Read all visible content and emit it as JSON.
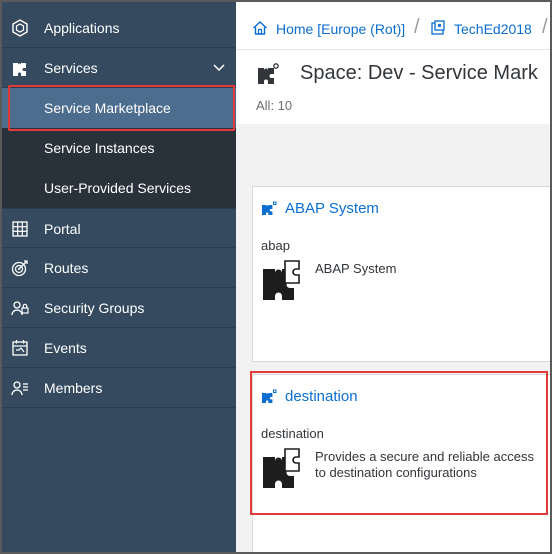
{
  "sidebar": {
    "items": [
      {
        "label": "Applications",
        "icon": "applications-icon"
      },
      {
        "label": "Services",
        "icon": "services-icon"
      },
      {
        "label": "Service Marketplace"
      },
      {
        "label": "Service Instances"
      },
      {
        "label": "User-Provided Services"
      },
      {
        "label": "Portal",
        "icon": "portal-grid-icon"
      },
      {
        "label": "Routes",
        "icon": "routes-target-icon"
      },
      {
        "label": "Security Groups",
        "icon": "security-groups-icon"
      },
      {
        "label": "Events",
        "icon": "events-calendar-icon"
      },
      {
        "label": "Members",
        "icon": "members-icon"
      }
    ]
  },
  "breadcrumb": {
    "home": "Home [Europe (Rot)]",
    "org": "TechEd2018",
    "separator": "/"
  },
  "header": {
    "title": "Space: Dev - Service Mark",
    "count": "All: 10"
  },
  "tiles": [
    {
      "title": "ABAP System",
      "name": "abap",
      "description": "ABAP System"
    },
    {
      "title": "destination",
      "name": "destination",
      "description": "Provides a secure and reliable access to destination configurations"
    }
  ],
  "colors": {
    "sidebar_bg": "#354a5f",
    "selected_bg": "#4d6d8e",
    "link": "#0a6ed1",
    "highlight": "#e03a3a"
  }
}
